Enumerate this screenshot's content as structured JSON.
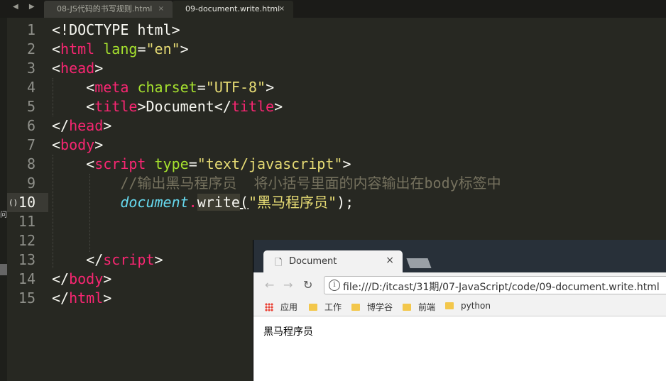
{
  "editor": {
    "nav_arrows": "◀ ▶",
    "tabs": [
      {
        "label": "08-JS代码的书写规则.html",
        "close": "×"
      },
      {
        "label": "09-document.write.html",
        "close": "×"
      }
    ],
    "side_char": "问",
    "fold_marker": "()",
    "line_numbers": [
      "1",
      "2",
      "3",
      "4",
      "5",
      "6",
      "7",
      "8",
      "9",
      "10",
      "11",
      "12",
      "13",
      "14",
      "15"
    ]
  },
  "code": {
    "l1": "<!DOCTYPE html>",
    "l2_open": "<",
    "l2_tag": "html",
    "l2_attr": "lang",
    "l2_eq": "=",
    "l2_val": "\"en\"",
    "l2_close": ">",
    "l3_open": "<",
    "l3_tag": "head",
    "l3_close": ">",
    "l4_open": "<",
    "l4_tag": "meta",
    "l4_attr": "charset",
    "l4_eq": "=",
    "l4_val": "\"UTF-8\"",
    "l4_close": ">",
    "l5_open": "<",
    "l5_tag": "title",
    "l5_mid": ">Document</",
    "l5_tag2": "title",
    "l5_close": ">",
    "l6_open": "</",
    "l6_tag": "head",
    "l6_close": ">",
    "l7_open": "<",
    "l7_tag": "body",
    "l7_close": ">",
    "l8_open": "<",
    "l8_tag": "script",
    "l8_attr": "type",
    "l8_eq": "=",
    "l8_val": "\"text/javascript\"",
    "l8_close": ">",
    "l9_comment": "//输出黑马程序员  将小括号里面的内容输出在body标签中",
    "l10_obj": "document",
    "l10_dot": ".",
    "l10_fn": "write",
    "l10_paren": "(",
    "l10_str": "\"黑马程序员\"",
    "l10_end": ");",
    "l13_open": "</",
    "l13_tag": "script",
    "l13_close": ">",
    "l14_open": "</",
    "l14_tag": "body",
    "l14_close": ">",
    "l15_open": "</",
    "l15_tag": "html",
    "l15_close": ">"
  },
  "browser": {
    "tab_icon": "🗋",
    "tab_title": "Document",
    "tab_close": "×",
    "back": "←",
    "forward": "→",
    "reload": "↻",
    "info": "i",
    "url": "file:///D:/itcast/31期/07-JavaScript/code/09-document.write.html",
    "bookmarks": [
      "应用",
      "工作",
      "博学谷",
      "前端",
      "python"
    ],
    "page_text": "黑马程序员"
  },
  "colors": {
    "editor_bg": "#272822",
    "tag": "#f92672",
    "attr": "#a6e22e",
    "string": "#e6db74",
    "comment": "#75715e",
    "object": "#66d9ef"
  }
}
